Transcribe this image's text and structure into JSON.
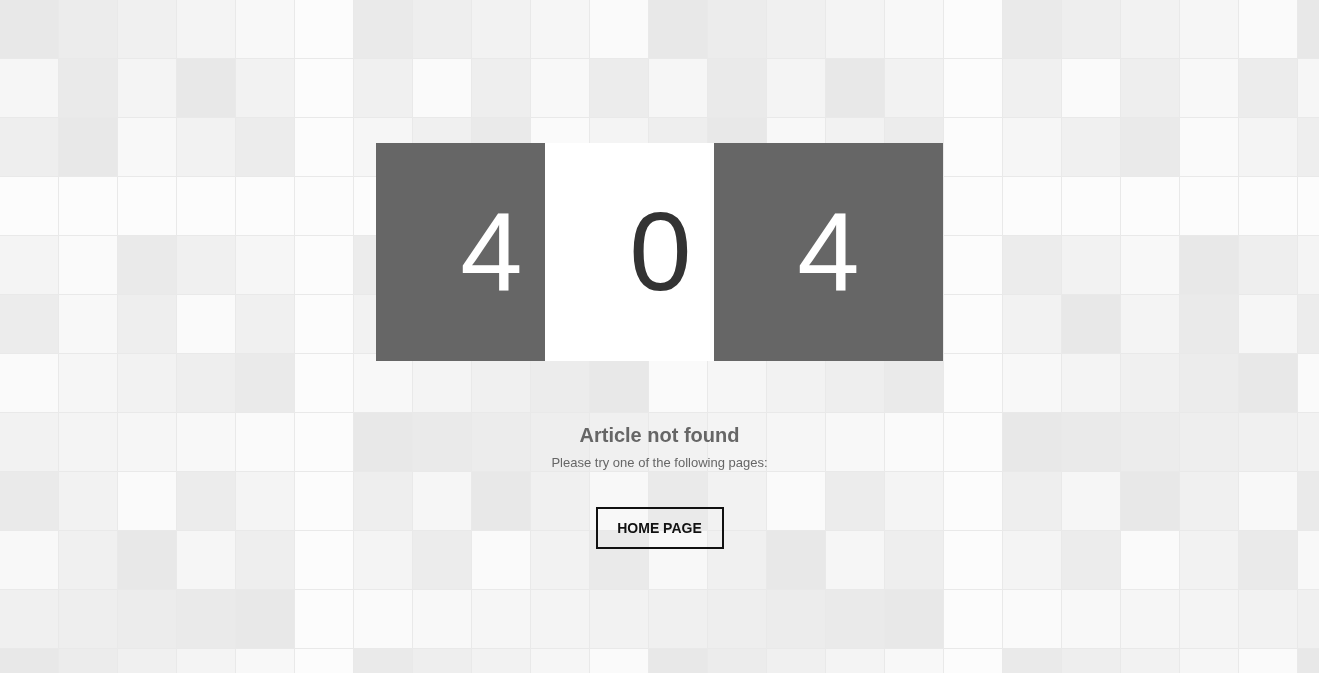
{
  "error_code": [
    {
      "digit": "4",
      "kind": "dark"
    },
    {
      "digit": "0",
      "kind": "light"
    },
    {
      "digit": "4",
      "kind": "dark"
    }
  ],
  "heading": "Article not found",
  "message": "Please try one of the following pages:",
  "button": "HOME PAGE"
}
